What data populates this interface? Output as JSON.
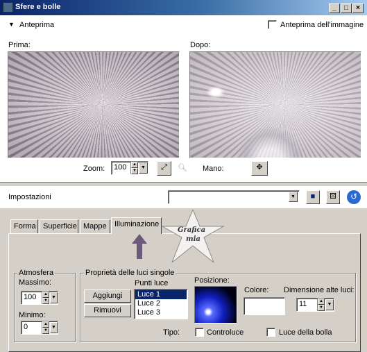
{
  "window": {
    "title": "Sfere e bolle"
  },
  "preview": {
    "toggle_label": "Anteprima",
    "image_preview_label": "Anteprima dell'immagine",
    "before_label": "Prima:",
    "after_label": "Dopo:",
    "zoom_label": "Zoom:",
    "zoom_value": "100",
    "hand_label": "Mano:"
  },
  "settings": {
    "label": "Impostazioni",
    "preset_value": ""
  },
  "tabs": [
    {
      "label": "Forma"
    },
    {
      "label": "Superficie"
    },
    {
      "label": "Mappe"
    },
    {
      "label": "Illuminazione"
    }
  ],
  "watermark": {
    "line1": "Grafica",
    "line2": "mia"
  },
  "atmosphere": {
    "title": "Atmosfera",
    "max_label": "Massimo:",
    "max_value": "100",
    "min_label": "Minimo:",
    "min_value": "0"
  },
  "lights": {
    "group_title": "Proprietà delle luci singole",
    "add_label": "Aggiungi",
    "remove_label": "Rimuovi",
    "list_label": "Punti luce",
    "items": [
      "Luce 1",
      "Luce 2",
      "Luce 3"
    ],
    "position_label": "Posizione:",
    "color_label": "Colore:",
    "size_label": "Dimensione alte luci:",
    "size_value": "11",
    "type_label": "Tipo:",
    "backlight_label": "Controluce",
    "bubble_light_label": "Luce della bolla"
  },
  "colors": {
    "accent": "#0a246a",
    "face": "#d4d0c8",
    "arrow": "#6b5a7a"
  }
}
